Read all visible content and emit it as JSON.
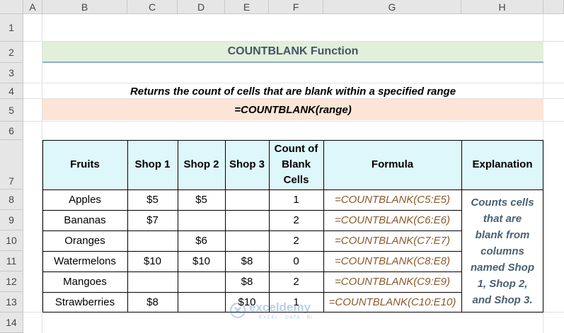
{
  "columns": [
    "A",
    "B",
    "C",
    "D",
    "E",
    "F",
    "G",
    "H"
  ],
  "rows": [
    "1",
    "2",
    "3",
    "4",
    "5",
    "6",
    "7",
    "8",
    "9",
    "10",
    "11",
    "12",
    "13",
    "14"
  ],
  "title": "COUNTBLANK Function",
  "description": "Returns the count of cells that are blank within a specified range",
  "syntax": "=COUNTBLANK(range)",
  "table": {
    "headers": {
      "fruits": "Fruits",
      "shop1": "Shop 1",
      "shop2": "Shop 2",
      "shop3": "Shop 3",
      "count_line1": "Count of",
      "count_line2": "Blank",
      "count_line3": "Cells",
      "formula": "Formula",
      "explanation": "Explanation"
    },
    "rows": [
      {
        "fruit": "Apples",
        "shop1": "$5",
        "shop2": "$5",
        "shop3": "",
        "count": "1",
        "formula": "=COUNTBLANK(C5:E5)"
      },
      {
        "fruit": "Bananas",
        "shop1": "$7",
        "shop2": "",
        "shop3": "",
        "count": "2",
        "formula": "=COUNTBLANK(C6:E6)"
      },
      {
        "fruit": "Oranges",
        "shop1": "",
        "shop2": "$6",
        "shop3": "",
        "count": "2",
        "formula": "=COUNTBLANK(C7:E7)"
      },
      {
        "fruit": "Watermelons",
        "shop1": "$10",
        "shop2": "$10",
        "shop3": "$8",
        "count": "0",
        "formula": "=COUNTBLANK(C8:E8)"
      },
      {
        "fruit": "Mangoes",
        "shop1": "",
        "shop2": "",
        "shop3": "$8",
        "count": "2",
        "formula": "=COUNTBLANK(C9:E9)"
      },
      {
        "fruit": "Strawberries",
        "shop1": "$8",
        "shop2": "",
        "shop3": "$10",
        "count": "1",
        "formula": "=COUNTBLANK(C10:E10)"
      }
    ],
    "explanation_lines": [
      "Counts cells",
      "that are",
      "blank from",
      "columns",
      "named Shop",
      "1, Shop 2,",
      "and Shop 3."
    ]
  },
  "watermark": {
    "name": "exceldemy",
    "tagline": "EXCEL · DATA · BI"
  },
  "colors": {
    "title_fill": "#e2efda",
    "title_text": "#44546a",
    "title_rule": "#8eaadb",
    "syntax_fill": "#fce4d6",
    "header_fill": "#ddf7fb",
    "formula_text": "#8a5a2b",
    "explanation_text": "#4a6072"
  }
}
